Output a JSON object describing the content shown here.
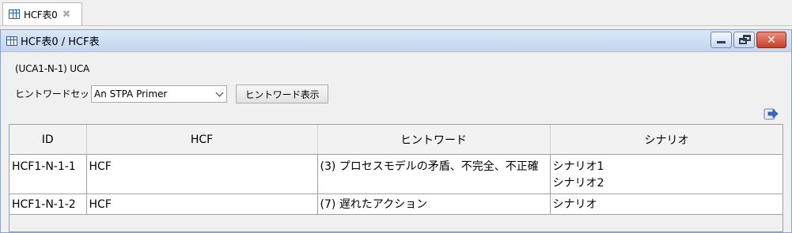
{
  "tab": {
    "label": "HCF表0",
    "close_glyph": "✖"
  },
  "window": {
    "title": "HCF表0 / HCF表",
    "minimize_label": "minimize",
    "restore_label": "restore",
    "close_glyph": "✕"
  },
  "path_text": "(UCA1-N-1) UCA",
  "hint_set": {
    "label": "ヒントワードセット",
    "selected": "An STPA Primer",
    "button_label": "ヒントワード表示"
  },
  "table": {
    "headers": [
      "ID",
      "HCF",
      "ヒントワード",
      "シナリオ"
    ],
    "rows": [
      {
        "id": "HCF1-N-1-1",
        "hcf": "HCF",
        "hint": "(3) プロセスモデルの矛盾、不完全、不正確",
        "scenarios": [
          "シナリオ1",
          "シナリオ2"
        ]
      },
      {
        "id": "HCF1-N-1-2",
        "hcf": "HCF",
        "hint": "(7) 遅れたアクション",
        "scenarios": [
          "シナリオ"
        ]
      }
    ]
  },
  "icons": {
    "tab_icon": "table-icon",
    "title_icon": "table-icon",
    "export_icon": "export-arrow-icon"
  },
  "colors": {
    "titlebar": "#c3d6ef",
    "close_button": "#c3402a",
    "icon_blue": "#2a5db0"
  }
}
